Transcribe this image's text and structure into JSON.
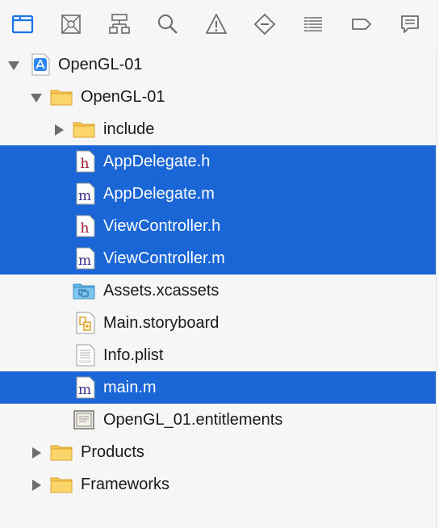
{
  "toolbar": {
    "items": [
      {
        "name": "folder-icon",
        "active": true
      },
      {
        "name": "source-control-icon"
      },
      {
        "name": "hierarchy-icon"
      },
      {
        "name": "search-icon"
      },
      {
        "name": "warning-icon"
      },
      {
        "name": "breakpoint-diamond-icon"
      },
      {
        "name": "list-icon"
      },
      {
        "name": "tag-icon"
      },
      {
        "name": "comment-icon"
      }
    ],
    "accent": "#1a73e8"
  },
  "tree": {
    "rows": [
      {
        "label": "OpenGL-01",
        "type": "project"
      },
      {
        "label": "OpenGL-01",
        "type": "folder"
      },
      {
        "label": "include",
        "type": "folder"
      },
      {
        "label": "AppDelegate.h",
        "type": "h-file",
        "selected": true
      },
      {
        "label": "AppDelegate.m",
        "type": "m-file",
        "selected": true
      },
      {
        "label": "ViewController.h",
        "type": "h-file",
        "selected": true
      },
      {
        "label": "ViewController.m",
        "type": "m-file",
        "selected": true
      },
      {
        "label": "Assets.xcassets",
        "type": "assets"
      },
      {
        "label": "Main.storyboard",
        "type": "storyboard"
      },
      {
        "label": "Info.plist",
        "type": "plist"
      },
      {
        "label": "main.m",
        "type": "m-file",
        "selected": true
      },
      {
        "label": "OpenGL_01.entitlements",
        "type": "entitlements"
      },
      {
        "label": "Products",
        "type": "folder"
      },
      {
        "label": "Frameworks",
        "type": "folder"
      }
    ],
    "selection_color": "#1a66d6"
  }
}
